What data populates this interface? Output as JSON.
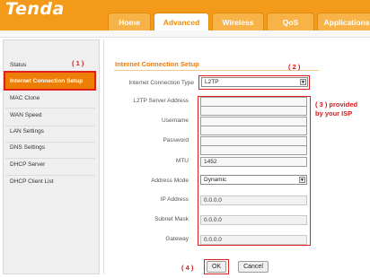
{
  "brand": {
    "logo_text": "Tenda"
  },
  "tabs": [
    {
      "label": "Home",
      "active": false
    },
    {
      "label": "Advanced",
      "active": true
    },
    {
      "label": "Wireless",
      "active": false
    },
    {
      "label": "QoS",
      "active": false
    },
    {
      "label": "Applications",
      "active": false
    }
  ],
  "sidebar": {
    "items": [
      {
        "label": "Status",
        "active": false
      },
      {
        "label": "Internet Connection Setup",
        "active": true
      },
      {
        "label": "MAC Clone",
        "active": false
      },
      {
        "label": "WAN Speed",
        "active": false
      },
      {
        "label": "LAN Settings",
        "active": false
      },
      {
        "label": "DNS Settings",
        "active": false
      },
      {
        "label": "DHCP Server",
        "active": false
      },
      {
        "label": "DHCP Client List",
        "active": false
      }
    ]
  },
  "main": {
    "title": "Internet Connection Setup",
    "connection_type": {
      "label": "Internet Connection Type",
      "value": "L2TP"
    },
    "fields": {
      "server": {
        "label": "L2TP Server Address",
        "value": ""
      },
      "username": {
        "label": "Username",
        "value": ""
      },
      "password": {
        "label": "Password",
        "value": ""
      },
      "mtu": {
        "label": "MTU",
        "value": "1452"
      },
      "address_mode": {
        "label": "Address Mode",
        "value": "Dynamic"
      },
      "ip": {
        "label": "IP Address",
        "value": "0.0.0.0"
      },
      "mask": {
        "label": "Subnet Mask",
        "value": "0.0.0.0"
      },
      "gateway": {
        "label": "Gateway",
        "value": "0.0.0.0"
      }
    },
    "buttons": {
      "ok": "OK",
      "cancel": "Cancel"
    }
  },
  "annotations": {
    "step1": "( 1 )",
    "step2": "( 2 )",
    "step3_line1": "( 3 ) provided",
    "step3_line2": "by your ISP",
    "step4": "( 4 )"
  },
  "colors": {
    "header_orange": "#f39a1a",
    "active_item": "#ee7d06",
    "title_orange": "#e87c0c",
    "annotation_red": "#d51a1a"
  }
}
